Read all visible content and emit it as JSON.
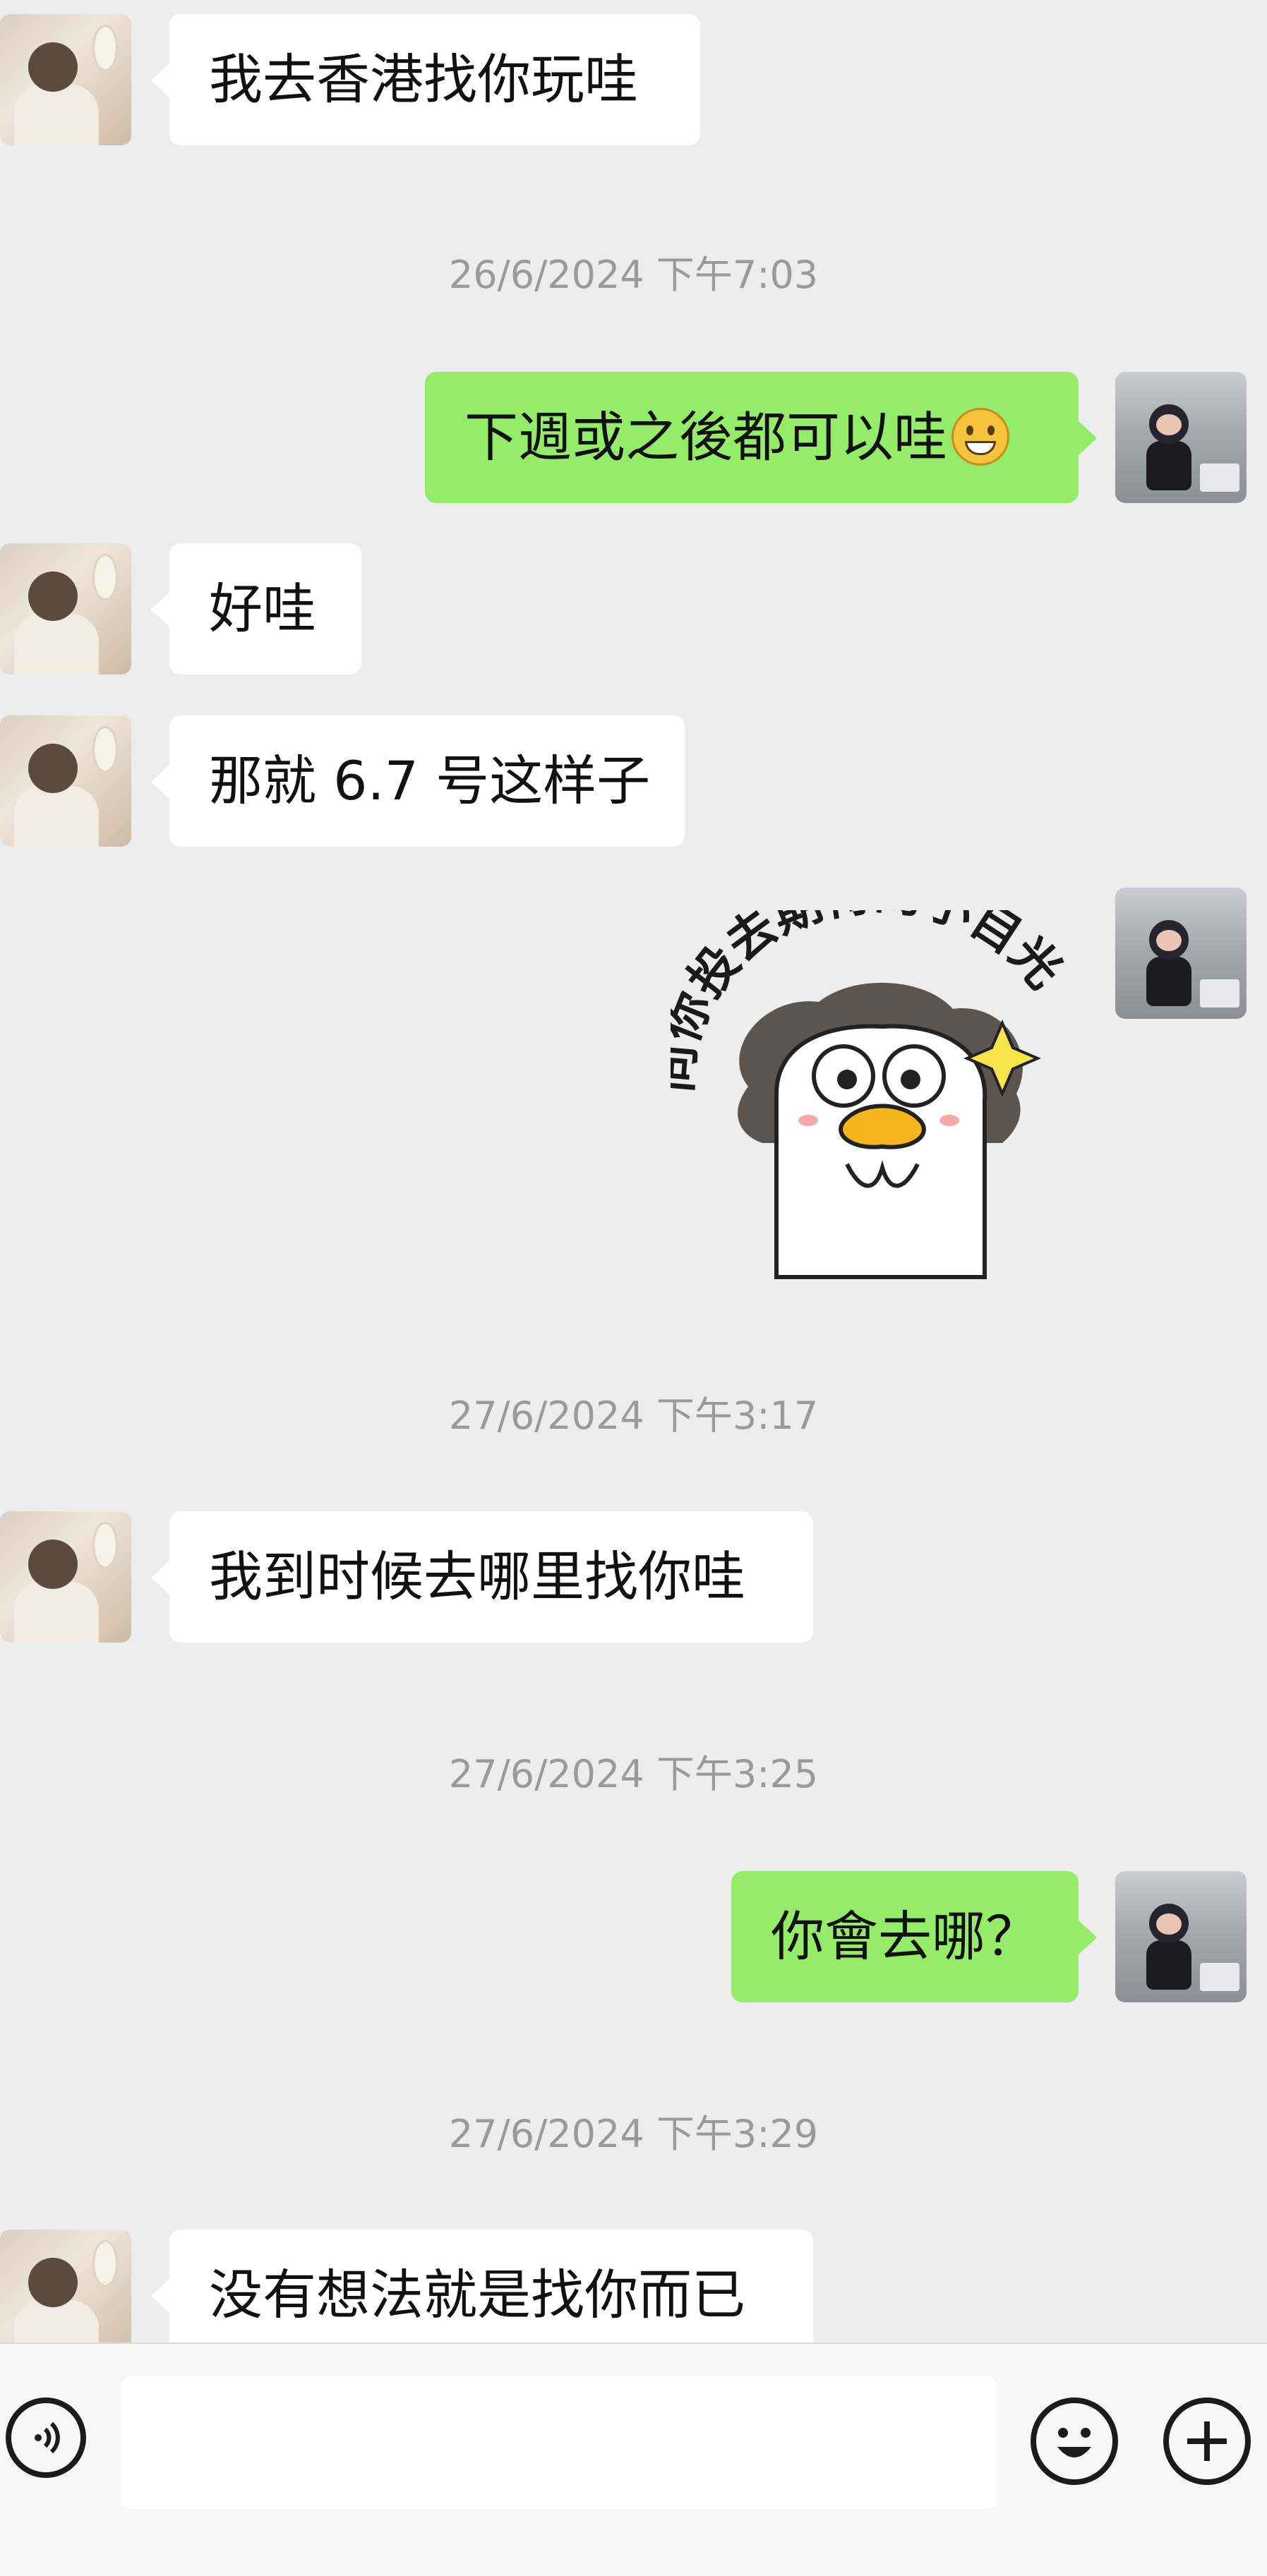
{
  "messages": [
    {
      "sender": "other",
      "text": "我去香港找你玩哇"
    },
    {
      "type": "timestamp",
      "text": "26/6/2024 下午7:03"
    },
    {
      "sender": "me",
      "text": "下週或之後都可以哇",
      "emoji": "grinning-emoji"
    },
    {
      "sender": "other",
      "text": "好哇"
    },
    {
      "sender": "other",
      "text": "那就 6.7 号这样子"
    },
    {
      "sender": "me",
      "type": "sticker",
      "sticker_text": "向你投去期待的小目光",
      "sticker_icon": "duck-sticker"
    },
    {
      "type": "timestamp",
      "text": "27/6/2024 下午3:17"
    },
    {
      "sender": "other",
      "text": "我到时候去哪里找你哇"
    },
    {
      "type": "timestamp",
      "text": "27/6/2024 下午3:25"
    },
    {
      "sender": "me",
      "text": "你會去哪？"
    },
    {
      "type": "timestamp",
      "text": "27/6/2024 下午3:29"
    },
    {
      "sender": "other",
      "text": "没有想法就是找你而已"
    }
  ],
  "input_bar": {
    "voice_icon": "voice-icon",
    "text_value": "",
    "emoji_icon": "emoji-icon",
    "plus_icon": "plus-icon"
  },
  "colors": {
    "background": "#ededed",
    "outgoing_bubble": "#95ec69",
    "incoming_bubble": "#ffffff",
    "timestamp": "#9a9a9a"
  }
}
